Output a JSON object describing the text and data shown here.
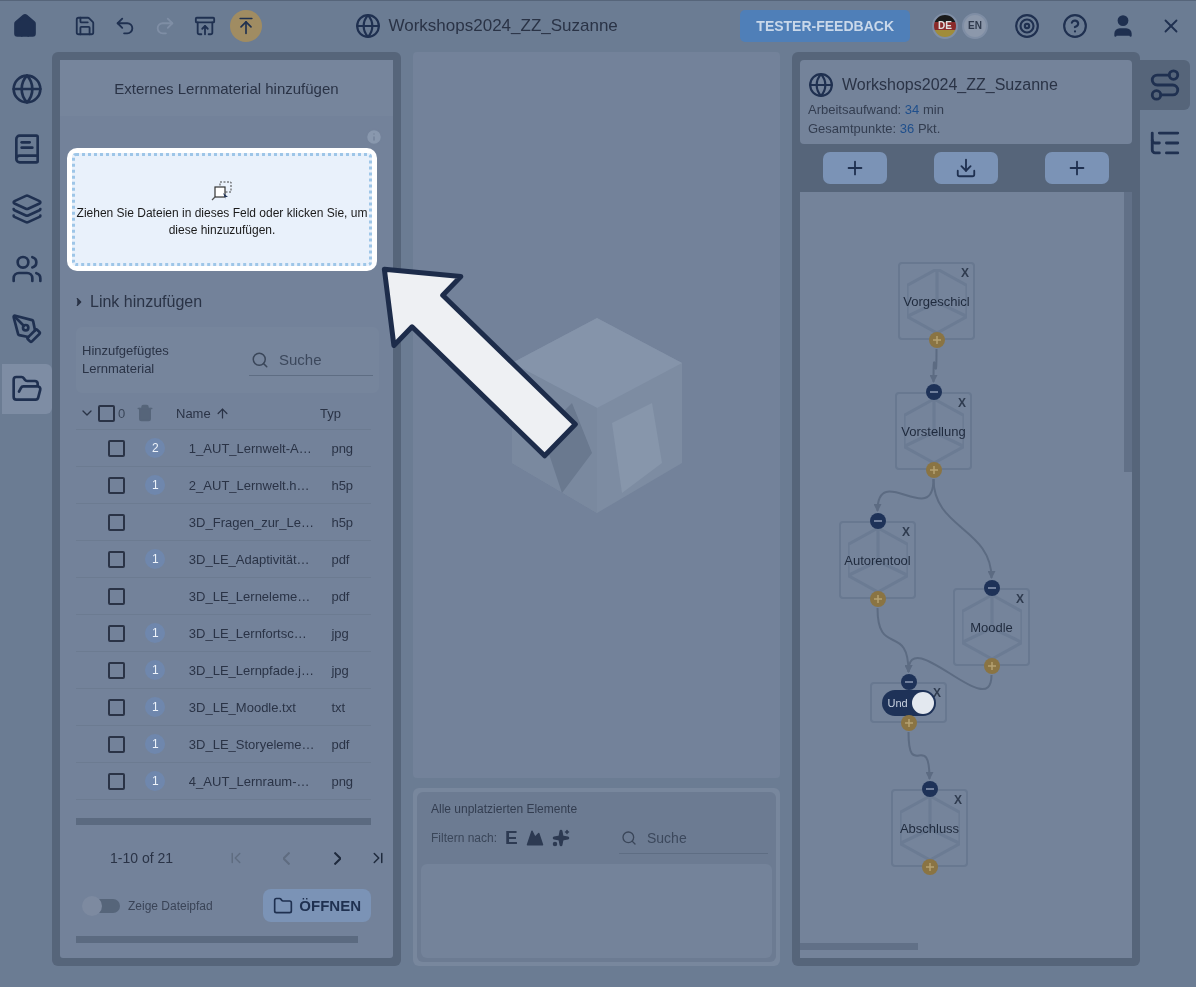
{
  "toolbar": {
    "title": "Workshops2024_ZZ_Suzanne",
    "feedback_button": "TESTER-FEEDBACK",
    "undo_disabled": false,
    "redo_disabled": true,
    "languages": [
      {
        "label": "DE",
        "selected": true
      },
      {
        "label": "EN",
        "selected": false
      }
    ]
  },
  "side_rail": {
    "items": [
      {
        "selected": false
      },
      {
        "selected": false
      },
      {
        "selected": false
      },
      {
        "selected": false
      },
      {
        "selected": false
      },
      {
        "selected": true
      }
    ]
  },
  "material_panel": {
    "title": "Externes Lernmaterial hinzufügen",
    "dropzone_text": "Ziehen Sie Dateien in dieses Feld oder klicken Sie, um diese hinzuzufügen.",
    "link_section": {
      "label": "Link hinzufügen",
      "expanded": false
    },
    "list_title": "Hinzufgefügtes Lernmaterial",
    "search_placeholder": "Suche",
    "all_checked": false,
    "selected_count": "0",
    "columns": [
      "Name",
      "Typ"
    ],
    "rows": [
      {
        "checked": false,
        "usage": "2",
        "name": "1_AUT_Lernwelt-A…",
        "type": "png"
      },
      {
        "checked": false,
        "usage": "1",
        "name": "2_AUT_Lernwelt.h…",
        "type": "h5p"
      },
      {
        "checked": false,
        "name": "3D_Fragen_zur_Le…",
        "type": "h5p"
      },
      {
        "checked": false,
        "usage": "1",
        "name": "3D_LE_Adaptivität…",
        "type": "pdf"
      },
      {
        "checked": false,
        "name": "3D_LE_Lerneleme…",
        "type": "pdf"
      },
      {
        "checked": false,
        "usage": "1",
        "name": "3D_LE_Lernfortsc…",
        "type": "jpg"
      },
      {
        "checked": false,
        "usage": "1",
        "name": "3D_LE_Lernpfade.j…",
        "type": "jpg"
      },
      {
        "checked": false,
        "usage": "1",
        "name": "3D_LE_Moodle.txt",
        "type": "txt"
      },
      {
        "checked": false,
        "usage": "1",
        "name": "3D_LE_Storyeleme…",
        "type": "pdf"
      },
      {
        "checked": false,
        "usage": "1",
        "name": "4_AUT_Lernraum-…",
        "type": "png"
      }
    ],
    "pagination": {
      "range": "1-10 of 21",
      "can_go_back": false,
      "can_go_forward": true
    },
    "show_path": {
      "label": "Zeige Dateipfad",
      "on": false
    },
    "open_button": "ÖFFNEN"
  },
  "unplaced_panel": {
    "title": "Alle unplatzierten Elemente",
    "filter_label": "Filtern nach:",
    "filter_letter": "E",
    "search_placeholder": "Suche"
  },
  "world_panel": {
    "title": "Workshops2024_ZZ_Suzanne",
    "effort_label": "Arbeitsaufwand:",
    "effort_value": "34",
    "effort_unit": "min",
    "points_label": "Gesamtpunkte:",
    "points_value": "36",
    "points_unit": "Pkt."
  },
  "graph": {
    "nodes": [
      {
        "kind": "space",
        "label": "Vorgeschicl",
        "delete": "X"
      },
      {
        "kind": "space",
        "label": "Vorstellung",
        "delete": "X"
      },
      {
        "kind": "space",
        "label": "Autorentool",
        "delete": "X"
      },
      {
        "kind": "space",
        "label": "Moodle",
        "delete": "X"
      },
      {
        "kind": "condition",
        "label": "Und",
        "on": true,
        "delete": "X"
      },
      {
        "kind": "space",
        "label": "Abschluss",
        "delete": "X"
      }
    ]
  },
  "right_rail": {
    "items": [
      {
        "selected": true
      },
      {
        "selected": false
      }
    ]
  }
}
